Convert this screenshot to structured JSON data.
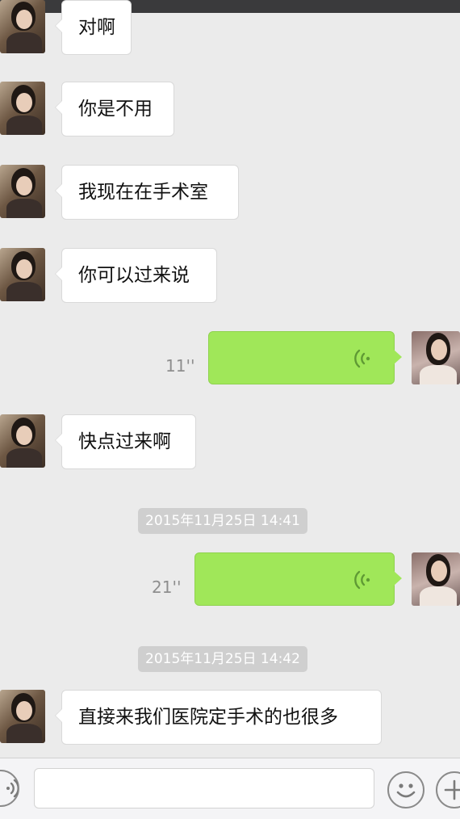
{
  "messages": [
    {
      "side": "left",
      "type": "text",
      "text": "对啊"
    },
    {
      "side": "left",
      "type": "text",
      "text": "你是不用"
    },
    {
      "side": "left",
      "type": "text",
      "text": "我现在在手术室"
    },
    {
      "side": "left",
      "type": "text",
      "text": "你可以过来说"
    },
    {
      "side": "right",
      "type": "voice",
      "duration": "11''"
    },
    {
      "side": "left",
      "type": "text",
      "text": "快点过来啊"
    },
    {
      "type": "timestamp",
      "text": "2015年11月25日 14:41"
    },
    {
      "side": "right",
      "type": "voice",
      "duration": "21''"
    },
    {
      "type": "timestamp",
      "text": "2015年11月25日 14:42"
    },
    {
      "side": "left",
      "type": "text",
      "text": "直接来我们医院定手术的也很多"
    }
  ],
  "composer": {
    "input_value": "",
    "voice_icon": "voice-wave-icon",
    "emoji_icon": "smiley-icon",
    "add_icon": "plus-icon"
  },
  "colors": {
    "background": "#ebebeb",
    "sent_bubble": "#a0e759",
    "received_bubble": "#ffffff",
    "timestamp_bg": "#cfcfcf"
  }
}
